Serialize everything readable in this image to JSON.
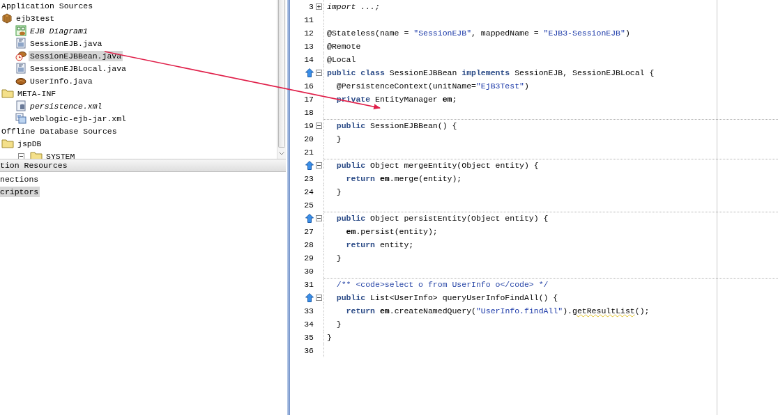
{
  "navigator": {
    "tree": [
      {
        "label": "Application Sources",
        "kind": "group",
        "italic": false,
        "selected": false,
        "children": [
          {
            "label": "ejb3test",
            "kind": "package",
            "italic": false,
            "selected": false,
            "children": [
              {
                "label": "EJB Diagram1",
                "kind": "diagram",
                "italic": true,
                "selected": false
              },
              {
                "label": "SessionEJB.java",
                "kind": "interface",
                "italic": false,
                "selected": false
              },
              {
                "label": "SessionEJBBean.java",
                "kind": "bean",
                "italic": false,
                "selected": true
              },
              {
                "label": "SessionEJBLocal.java",
                "kind": "interface",
                "italic": false,
                "selected": false
              },
              {
                "label": "UserInfo.java",
                "kind": "entity",
                "italic": false,
                "selected": false
              }
            ]
          },
          {
            "label": "META-INF",
            "kind": "folder",
            "italic": false,
            "selected": false,
            "children": [
              {
                "label": "persistence.xml",
                "kind": "persistence",
                "italic": true,
                "selected": false
              },
              {
                "label": "weblogic-ejb-jar.xml",
                "kind": "xml",
                "italic": false,
                "selected": false
              }
            ]
          }
        ]
      },
      {
        "label": "Offline Database Sources",
        "kind": "group",
        "italic": false,
        "selected": false,
        "children": [
          {
            "label": "jspDB",
            "kind": "folder",
            "italic": false,
            "selected": false,
            "children": [
              {
                "label": "SYSTEM",
                "kind": "folder",
                "italic": false,
                "selected": false,
                "expanded": true
              }
            ]
          }
        ]
      }
    ]
  },
  "resources": {
    "title": "tion Resources",
    "items": [
      {
        "label": "nections",
        "selected": false
      },
      {
        "label": "criptors",
        "selected": true
      }
    ]
  },
  "editor": {
    "lines": [
      {
        "number": "3",
        "overrides": false,
        "collapsed": true,
        "separator": false,
        "tokens": [
          {
            "kind": "folded",
            "t": "import ...;"
          }
        ]
      },
      {
        "number": "11",
        "overrides": false,
        "separator": false
      },
      {
        "number": "12",
        "overrides": false,
        "separator": false,
        "tokens": [
          {
            "kind": "plain",
            "t": "@Stateless(name = "
          },
          {
            "kind": "string",
            "t": "\"SessionEJB\""
          },
          {
            "kind": "plain",
            "t": ", mappedName = "
          },
          {
            "kind": "string",
            "t": "\"EJB3-SessionEJB\""
          },
          {
            "kind": "plain",
            "t": ")"
          }
        ]
      },
      {
        "number": "13",
        "overrides": false,
        "separator": false,
        "tokens": [
          {
            "kind": "plain",
            "t": "@Remote"
          }
        ]
      },
      {
        "number": "14",
        "overrides": false,
        "separator": false,
        "tokens": [
          {
            "kind": "plain",
            "t": "@Local"
          }
        ]
      },
      {
        "overrides": true,
        "collapsed": false,
        "separator": false,
        "tokens": [
          {
            "kind": "keyword",
            "t": "public class"
          },
          {
            "kind": "plain",
            "t": " SessionEJBBean "
          },
          {
            "kind": "keyword",
            "t": "implements"
          },
          {
            "kind": "plain",
            "t": " SessionEJB, SessionEJBLocal {"
          }
        ]
      },
      {
        "number": "16",
        "overrides": false,
        "separator": false,
        "tokens": [
          {
            "kind": "plain",
            "t": "  @PersistenceContext(unitName="
          },
          {
            "kind": "string",
            "t": "\"EjB3Test\""
          },
          {
            "kind": "plain",
            "t": ")"
          }
        ]
      },
      {
        "number": "17",
        "overrides": false,
        "separator": false,
        "tokens": [
          {
            "kind": "keyword",
            "t": "  private"
          },
          {
            "kind": "plain",
            "t": " EntityManager "
          },
          {
            "kind": "field",
            "t": "em"
          },
          {
            "kind": "plain",
            "t": ";"
          }
        ]
      },
      {
        "number": "18",
        "overrides": false,
        "separator": false
      },
      {
        "number": "19",
        "overrides": false,
        "collapsed": false,
        "separator": true,
        "tokens": [
          {
            "kind": "keyword",
            "t": "  public"
          },
          {
            "kind": "plain",
            "t": " SessionEJBBean() {"
          }
        ]
      },
      {
        "number": "20",
        "overrides": false,
        "separator": false,
        "tokens": [
          {
            "kind": "plain",
            "t": "  }"
          }
        ]
      },
      {
        "number": "21",
        "overrides": false,
        "separator": false
      },
      {
        "overrides": true,
        "collapsed": false,
        "separator": true,
        "tokens": [
          {
            "kind": "keyword",
            "t": "  public"
          },
          {
            "kind": "plain",
            "t": " Object mergeEntity(Object entity) {"
          }
        ]
      },
      {
        "number": "23",
        "overrides": false,
        "separator": false,
        "tokens": [
          {
            "kind": "keyword",
            "t": "    return"
          },
          {
            "kind": "field",
            "t": " em"
          },
          {
            "kind": "plain",
            "t": ".merge(entity);"
          }
        ]
      },
      {
        "number": "24",
        "overrides": false,
        "separator": false,
        "tokens": [
          {
            "kind": "plain",
            "t": "  }"
          }
        ]
      },
      {
        "number": "25",
        "overrides": false,
        "separator": false
      },
      {
        "overrides": true,
        "collapsed": false,
        "separator": true,
        "tokens": [
          {
            "kind": "keyword",
            "t": "  public"
          },
          {
            "kind": "plain",
            "t": " Object persistEntity(Object entity) {"
          }
        ]
      },
      {
        "number": "27",
        "overrides": false,
        "separator": false,
        "tokens": [
          {
            "kind": "field",
            "t": "    em"
          },
          {
            "kind": "plain",
            "t": ".persist(entity);"
          }
        ]
      },
      {
        "number": "28",
        "overrides": false,
        "separator": false,
        "tokens": [
          {
            "kind": "keyword",
            "t": "    return"
          },
          {
            "kind": "plain",
            "t": " entity;"
          }
        ]
      },
      {
        "number": "29",
        "overrides": false,
        "separator": false,
        "tokens": [
          {
            "kind": "plain",
            "t": "  }"
          }
        ]
      },
      {
        "number": "30",
        "overrides": false,
        "separator": false
      },
      {
        "number": "31",
        "overrides": false,
        "separator": true,
        "tokens": [
          {
            "kind": "comment",
            "t": "  /** <code>select o from UserInfo o</code> */"
          }
        ]
      },
      {
        "overrides": true,
        "collapsed": false,
        "separator": false,
        "tokens": [
          {
            "kind": "keyword",
            "t": "  public"
          },
          {
            "kind": "plain",
            "t": " List<UserInfo> queryUserInfoFindAll() {"
          }
        ]
      },
      {
        "number": "33",
        "overrides": false,
        "separator": false,
        "tokens": [
          {
            "kind": "keyword",
            "t": "    return"
          },
          {
            "kind": "field",
            "t": " em"
          },
          {
            "kind": "plain",
            "t": ".createNamedQuery("
          },
          {
            "kind": "string",
            "t": "\"UserInfo.findAll\""
          },
          {
            "kind": "plain",
            "t": ")."
          },
          {
            "kind": "warning",
            "t": "getResultList"
          },
          {
            "kind": "plain",
            "t": "();"
          }
        ]
      },
      {
        "number": "34",
        "overrides": false,
        "separator": false,
        "tokens": [
          {
            "kind": "plain",
            "t": "  }"
          }
        ]
      },
      {
        "number": "35",
        "overrides": false,
        "separator": false,
        "tokens": [
          {
            "kind": "plain",
            "t": "}"
          }
        ]
      },
      {
        "number": "36",
        "overrides": false,
        "separator": false
      }
    ]
  }
}
